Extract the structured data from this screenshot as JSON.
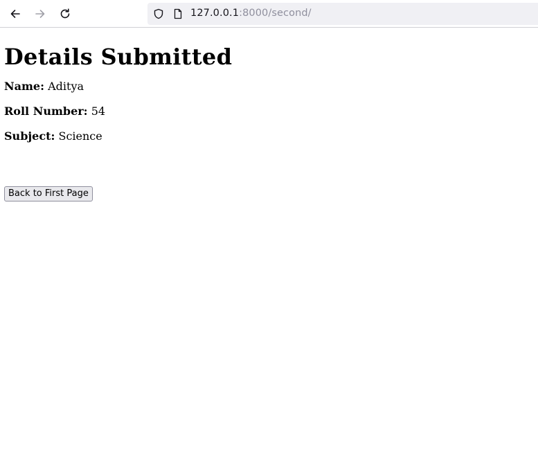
{
  "browser": {
    "url_host": "127.0.0.1",
    "url_rest": ":8000/second/",
    "icons": {
      "back": "arrow-left-icon",
      "forward": "arrow-right-icon",
      "reload": "reload-icon",
      "tracking": "shield-icon",
      "page": "page-icon"
    }
  },
  "page": {
    "heading": "Details Submitted",
    "fields": [
      {
        "label": "Name:",
        "value": "Aditya"
      },
      {
        "label": "Roll Number:",
        "value": "54"
      },
      {
        "label": "Subject:",
        "value": "Science"
      }
    ],
    "button_label": "Back to First Page"
  }
}
